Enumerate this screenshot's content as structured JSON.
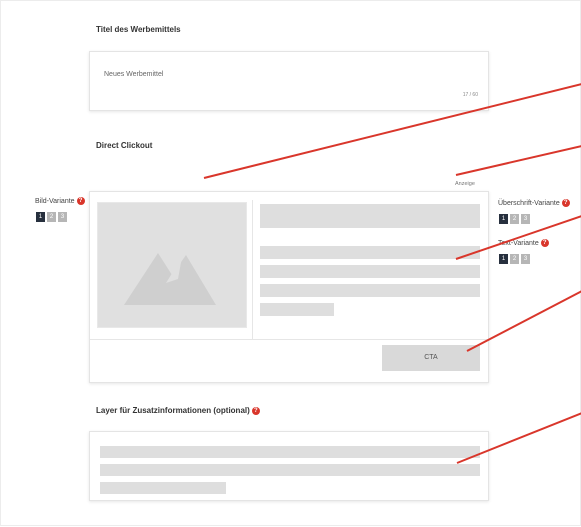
{
  "title_section": {
    "label": "Titel des Werbemittels"
  },
  "title_input": {
    "value": "Neues Werbemittel",
    "counter": "17 / 60"
  },
  "direct_clickout": {
    "label": "Direct Clickout",
    "anzeige": "Anzeige",
    "cta_label": "CTA"
  },
  "variants": {
    "bild": {
      "label": "Bild-Variante",
      "options": [
        "1",
        "2",
        "3"
      ],
      "selected": "1"
    },
    "ueberschrift": {
      "label": "Überschrift-Variante",
      "options": [
        "1",
        "2",
        "3"
      ],
      "selected": "1"
    },
    "text": {
      "label": "Text-Variante",
      "options": [
        "1",
        "2",
        "3"
      ],
      "selected": "1"
    }
  },
  "layer_section": {
    "label": "Layer für Zusatzinformationen (optional)"
  },
  "colors": {
    "accent_red": "#d9362b",
    "active_button": "#27303e",
    "inactive_button": "#b6b6b6",
    "placeholder_gray": "#dedede"
  }
}
